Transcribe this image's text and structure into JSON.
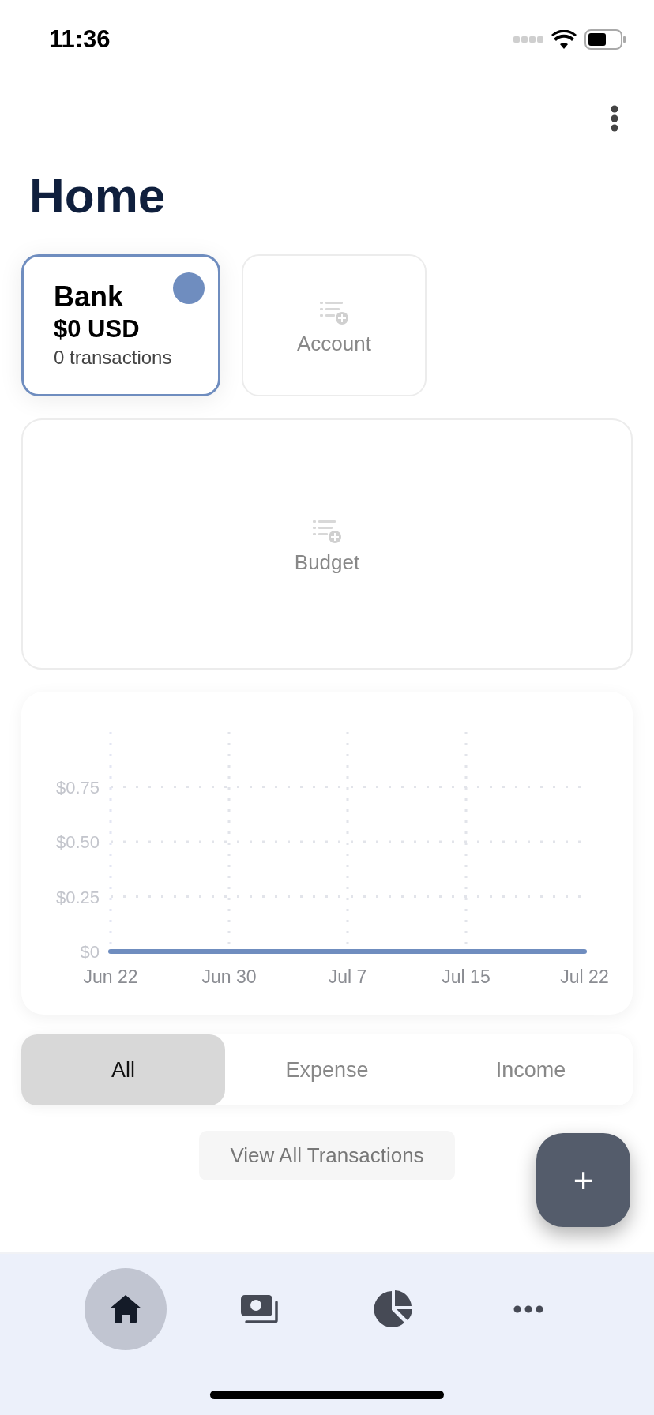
{
  "status_bar": {
    "time": "11:36"
  },
  "title": "Home",
  "accounts": [
    {
      "name": "Bank",
      "balance": "$0 USD",
      "transactions": "0 transactions",
      "selected": true,
      "color": "#6f8dbf"
    }
  ],
  "add_account": {
    "label": "Account"
  },
  "add_budget": {
    "label": "Budget"
  },
  "chart": {
    "chart_data": {
      "type": "line",
      "categories": [
        "Jun 22",
        "Jun 30",
        "Jul 7",
        "Jul 15",
        "Jul 22"
      ],
      "series": [
        {
          "color": "#6f8dbf",
          "values": [
            0,
            0,
            0,
            0,
            0
          ]
        }
      ],
      "grid": true,
      "ylim": [
        0,
        1
      ],
      "yticks": [
        {
          "value": 0,
          "label": "$0"
        },
        {
          "value": 0.25,
          "label": "$0.25"
        },
        {
          "value": 0.5,
          "label": "$0.50"
        },
        {
          "value": 0.75,
          "label": "$0.75"
        }
      ]
    }
  },
  "filter_tabs": [
    {
      "label": "All",
      "selected": true
    },
    {
      "label": "Expense",
      "selected": false
    },
    {
      "label": "Income",
      "selected": false
    }
  ],
  "view_all": {
    "label": "View All Transactions"
  },
  "fab": {
    "label": "+"
  },
  "nav": [
    {
      "kind": "home",
      "selected": true
    },
    {
      "kind": "money",
      "selected": false
    },
    {
      "kind": "pie",
      "selected": false
    },
    {
      "kind": "more",
      "selected": false
    }
  ]
}
